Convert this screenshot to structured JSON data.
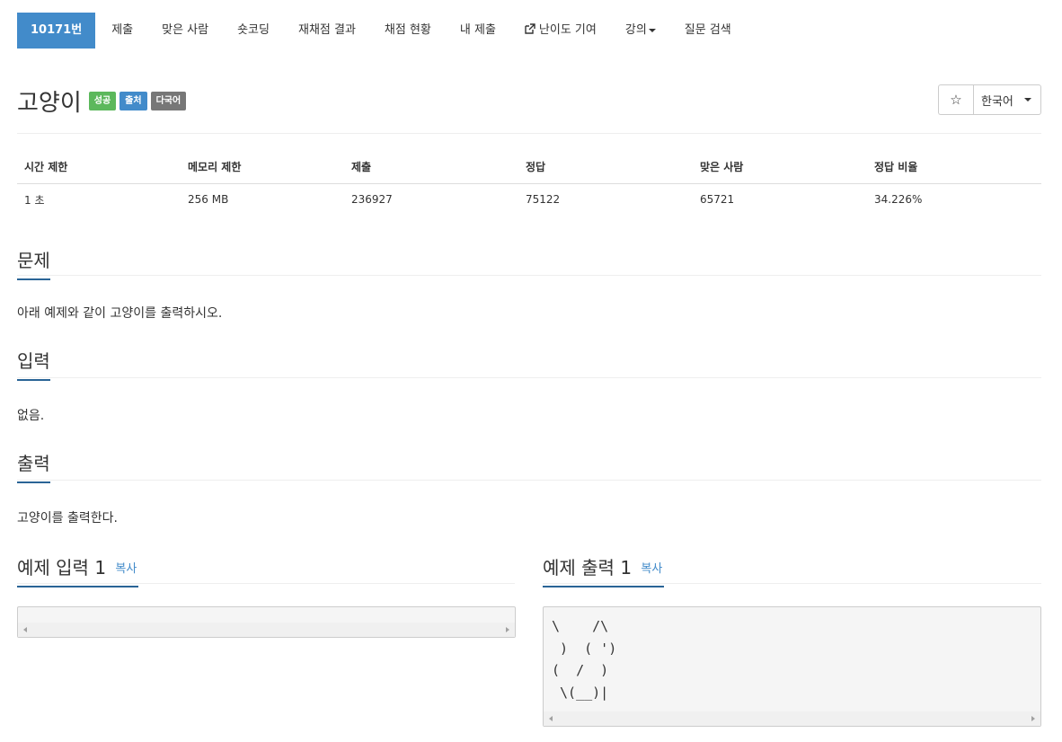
{
  "nav": {
    "items": [
      {
        "label": "10171번",
        "active": true
      },
      {
        "label": "제출"
      },
      {
        "label": "맞은 사람"
      },
      {
        "label": "숏코딩"
      },
      {
        "label": "재채점 결과"
      },
      {
        "label": "채점 현황"
      },
      {
        "label": "내 제출"
      },
      {
        "label": "난이도 기여",
        "icon": "external-link-icon"
      },
      {
        "label": "강의",
        "dropdown": true
      },
      {
        "label": "질문 검색"
      }
    ]
  },
  "problem": {
    "title": "고양이",
    "badges": {
      "success": "성공",
      "source": "출처",
      "multilang": "다국어"
    },
    "colors": {
      "success": "#5cb85c",
      "source": "#428bca",
      "multilang": "#777777",
      "accent": "#428bca"
    }
  },
  "toolbar": {
    "star": "☆",
    "language": "한국어"
  },
  "stats": {
    "headers": [
      "시간 제한",
      "메모리 제한",
      "제출",
      "정답",
      "맞은 사람",
      "정답 비율"
    ],
    "values": [
      "1 초",
      "256 MB",
      "236927",
      "75122",
      "65721",
      "34.226%"
    ]
  },
  "sections": {
    "problem_heading": "문제",
    "problem_text": "아래 예제와 같이 고양이를 출력하시오.",
    "input_heading": "입력",
    "input_text": "없음.",
    "output_heading": "출력",
    "output_text": "고양이를 출력한다."
  },
  "samples": {
    "input_heading": "예제 입력 1",
    "output_heading": "예제 출력 1",
    "copy_label": "복사",
    "input_value": "",
    "output_value": "\\    /\\\n )  ( ')\n(  /  )\n \\(__)|"
  }
}
